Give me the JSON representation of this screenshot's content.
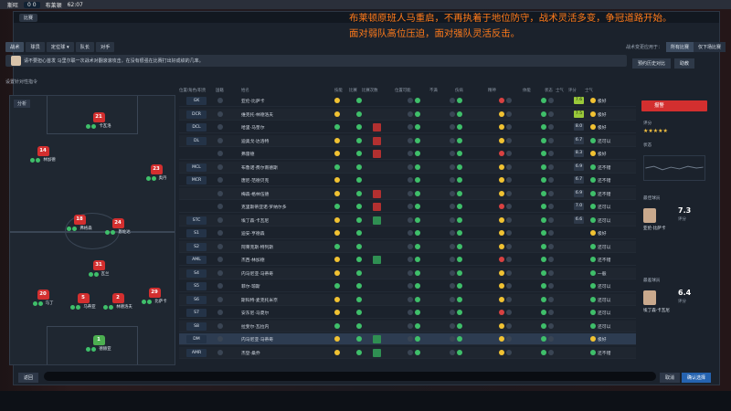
{
  "stream_bar": {
    "team_home": "斯旺",
    "score": "0 0",
    "team_away": "布莱顿",
    "time": "62:07"
  },
  "window": {
    "title_tab": "比赛"
  },
  "overlay_text": [
    "布莱顿原班人马重启，不再执着于地位防守，战术灵活多变，争冠道路开始。",
    "面对弱队高位压迫，面对强队灵活反击。"
  ],
  "tabs": [
    {
      "label": "战术",
      "active": true
    },
    {
      "label": "球员"
    },
    {
      "label": "定位球 ▾"
    },
    {
      "label": "队长"
    },
    {
      "label": "对手"
    }
  ],
  "top_right": {
    "label": "战术变更应用于：",
    "opt1": "所有比赛",
    "opt2": "仅下场比赛"
  },
  "message": {
    "text": "请不要担心首发 马里尔联一次战术对翻滚滚攻击，在没有很强在比赛打出好成绩的几率。"
  },
  "message_right": {
    "btn1": "预约历史对比",
    "btn2": "助教"
  },
  "section_label": "设置针对性指令",
  "pitch": {
    "control_label": "分析",
    "players": [
      {
        "num": "21",
        "name": "卡瓦洛",
        "gk": false
      },
      {
        "num": "14",
        "name": "林加德",
        "gk": false
      },
      {
        "num": "23",
        "name": "奥丹",
        "gk": false
      },
      {
        "num": "18",
        "name": "弗格森",
        "gk": false
      },
      {
        "num": "24",
        "name": "恩佐达",
        "gk": false
      },
      {
        "num": "31",
        "name": "瓦兰",
        "gk": false
      },
      {
        "num": "20",
        "name": "马丁",
        "gk": false
      },
      {
        "num": "5",
        "name": "马蒂亚",
        "gk": false
      },
      {
        "num": "2",
        "name": "林德洛夫",
        "gk": false
      },
      {
        "num": "29",
        "name": "比萨卡",
        "gk": false
      },
      {
        "num": "1",
        "name": "德赫亚",
        "gk": true
      }
    ]
  },
  "table": {
    "headers": [
      "位置/角色/职责",
      "国籍",
      "姓名",
      "技能",
      "比赛",
      "比赛次数",
      "位置可能",
      "不满",
      "伤病",
      "精神",
      "体能",
      "状态",
      "士气",
      "评分",
      "士气"
    ],
    "rows": [
      {
        "pos": "GK",
        "name": "亚伦·比萨卡",
        "rating": "7.6",
        "morale": "极好",
        "sq": "",
        "hi": true
      },
      {
        "pos": "DCR",
        "name": "维克托·林德洛夫",
        "rating": "7.5",
        "morale": "极好",
        "sq": "",
        "hi": true
      },
      {
        "pos": "DCL",
        "name": "哈里·马奎尔",
        "rating": "8.0",
        "morale": "极好",
        "sq": "red"
      },
      {
        "pos": "DL",
        "name": "迪奥戈·达洛特",
        "rating": "6.7",
        "morale": "还可以",
        "sq": "red"
      },
      {
        "pos": "",
        "name": "弗雷德",
        "rating": "8.3",
        "morale": "极好",
        "sq": "red"
      },
      {
        "pos": "MCL",
        "name": "布鲁诺·费尔南德斯",
        "rating": "6.9",
        "morale": "还不错",
        "sq": ""
      },
      {
        "pos": "MCR",
        "name": "唐尼·范德贝克",
        "rating": "6.7",
        "morale": "还不错",
        "sq": ""
      },
      {
        "pos": "",
        "name": "梅森·格林伍德",
        "rating": "6.9",
        "morale": "还不错",
        "sq": "red"
      },
      {
        "pos": "",
        "name": "克里斯蒂亚诺·罗纳尔多",
        "rating": "7.0",
        "morale": "还可以",
        "sq": "red"
      },
      {
        "pos": "STC",
        "name": "埃丁森·卡瓦尼",
        "rating": "6.6",
        "morale": "还可以",
        "sq": "grn"
      },
      {
        "pos": "S1",
        "name": "迪安·亨德森",
        "rating": "",
        "morale": "极好",
        "sq": ""
      },
      {
        "pos": "S2",
        "name": "阿莱克斯·特列斯",
        "rating": "",
        "morale": "还可以",
        "sq": ""
      },
      {
        "pos": "AML",
        "name": "杰西·林加德",
        "rating": "",
        "morale": "还不错",
        "sq": "grn"
      },
      {
        "pos": "S4",
        "name": "内马尼亚·马蒂奇",
        "rating": "",
        "morale": "一般",
        "sq": ""
      },
      {
        "pos": "S5",
        "name": "菲尔·琼斯",
        "rating": "",
        "morale": "还可以",
        "sq": ""
      },
      {
        "pos": "S6",
        "name": "斯科特·麦克托米奈",
        "rating": "",
        "morale": "还可以",
        "sq": ""
      },
      {
        "pos": "S7",
        "name": "安东尼·马夏尔",
        "rating": "",
        "morale": "还可以",
        "sq": ""
      },
      {
        "pos": "S8",
        "name": "拉斐尔·瓦拉内",
        "rating": "",
        "morale": "还可以",
        "sq": ""
      },
      {
        "pos": "DM",
        "name": "内马尼亚·马蒂奇",
        "rating": "",
        "morale": "极好",
        "sq": "grn"
      },
      {
        "pos": "AMR",
        "name": "杰登·桑乔",
        "rating": "",
        "morale": "还不错",
        "sq": "grn"
      }
    ]
  },
  "side": {
    "btn": "报警",
    "rating_label": "评分",
    "trend_label": "状态",
    "best_label": "最佳球员",
    "best": {
      "score": "7.3",
      "score_label": "评分",
      "name": "亚伦·比萨卡"
    },
    "worst_label": "最差球员",
    "worst": {
      "score": "6.4",
      "score_label": "评分",
      "name": "埃丁森·卡瓦尼"
    }
  },
  "bottom": {
    "left_btn": "返回",
    "cancel": "取消",
    "ok": "确认选择"
  }
}
